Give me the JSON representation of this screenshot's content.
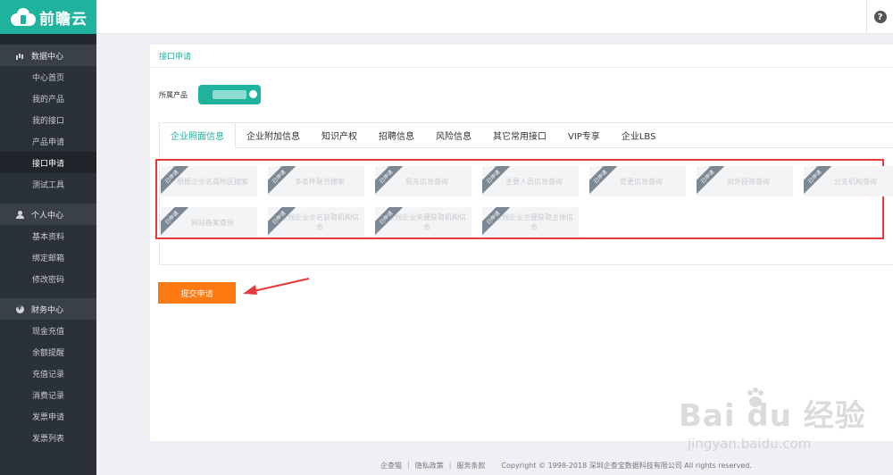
{
  "brand": {
    "name": "前瞻云"
  },
  "header": {
    "help_icon": "?"
  },
  "sidebar": {
    "groups": [
      {
        "title": "数据中心",
        "icon": "chart-icon",
        "items": [
          "中心首页",
          "我的产品",
          "我的接口",
          "产品申请",
          "接口申请",
          "测试工具"
        ]
      },
      {
        "title": "个人中心",
        "icon": "user-icon",
        "items": [
          "基本资料",
          "绑定邮箱",
          "修改密码"
        ]
      },
      {
        "title": "财务中心",
        "icon": "money-icon",
        "items": [
          "现金充值",
          "余额提醒",
          "充值记录",
          "消费记录",
          "发票申请",
          "发票列表"
        ]
      }
    ],
    "active_item": "接口申请"
  },
  "page": {
    "title": "接口申请",
    "product_label": "所属产品",
    "tabs": [
      "企业照面信息",
      "企业附加信息",
      "知识产权",
      "招聘信息",
      "风险信息",
      "其它常用接口",
      "VIP专享",
      "企业LBS"
    ],
    "active_tab": "企业照面信息",
    "ribbon_text": "已申请",
    "apis": [
      "根据企业名或地区搜索",
      "多条件联合搜索",
      "股东信息查询",
      "主要人员信息查询",
      "变更信息查询",
      "对外投资查询",
      "分支机构查询",
      "网站备案查询",
      "根据企业全名获取机构信息",
      "根据企业关键获取机构信息",
      "根据企业主键获取主体信息"
    ],
    "submit_label": "提交申请"
  },
  "footer": {
    "links": [
      "企查猫",
      "隐私政策",
      "服务条款"
    ],
    "copyright": "Copyright © 1998-2018 深圳企查宝数据科技有限公司 All rights reserved."
  },
  "watermark": {
    "text": "Bai du 经验",
    "url": "jingyan.baidu.com"
  },
  "colors": {
    "accent": "#1fb39e",
    "submit": "#ff7a12",
    "highlight": "#e5393b",
    "sidebar": "#2b3138"
  }
}
